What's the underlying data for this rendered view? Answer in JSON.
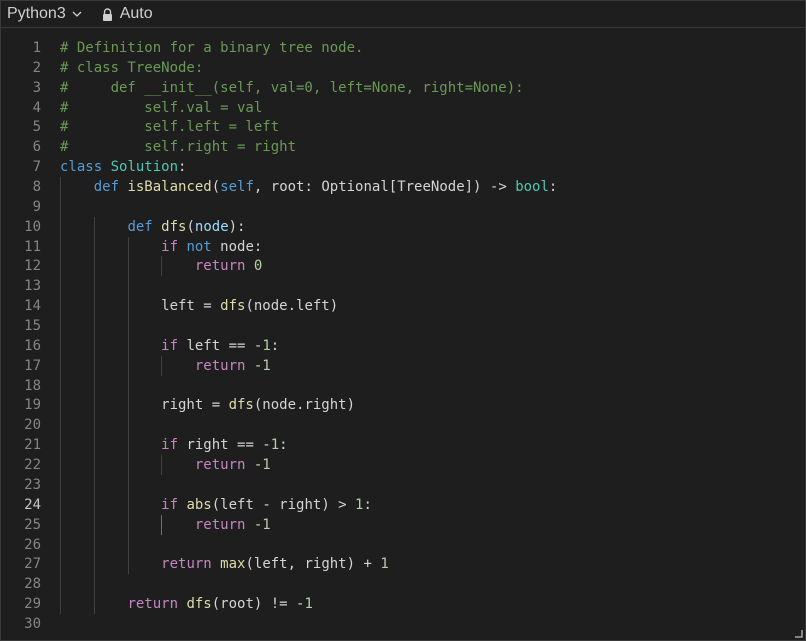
{
  "toolbar": {
    "language": "Python3",
    "language_icon": "chevron-down-icon",
    "mode": "Auto",
    "mode_icon": "lock-icon"
  },
  "editor": {
    "active_line": 24,
    "lines": [
      {
        "n": "1",
        "t": "# Definition for a binary tree node."
      },
      {
        "n": "2",
        "t": "# class TreeNode:"
      },
      {
        "n": "3",
        "t": "#     def __init__(self, val=0, left=None, right=None):"
      },
      {
        "n": "4",
        "t": "#         self.val = val"
      },
      {
        "n": "5",
        "t": "#         self.left = left"
      },
      {
        "n": "6",
        "t": "#         self.right = right"
      },
      {
        "n": "7",
        "t": "class Solution:"
      },
      {
        "n": "8",
        "t": "    def isBalanced(self, root: Optional[TreeNode]) -> bool:"
      },
      {
        "n": "9",
        "t": ""
      },
      {
        "n": "10",
        "t": "        def dfs(node):"
      },
      {
        "n": "11",
        "t": "            if not node:"
      },
      {
        "n": "12",
        "t": "                return 0"
      },
      {
        "n": "13",
        "t": ""
      },
      {
        "n": "14",
        "t": "            left = dfs(node.left)"
      },
      {
        "n": "15",
        "t": ""
      },
      {
        "n": "16",
        "t": "            if left == -1:"
      },
      {
        "n": "17",
        "t": "                return -1"
      },
      {
        "n": "18",
        "t": ""
      },
      {
        "n": "19",
        "t": "            right = dfs(node.right)"
      },
      {
        "n": "20",
        "t": ""
      },
      {
        "n": "21",
        "t": "            if right == -1:"
      },
      {
        "n": "22",
        "t": "                return -1"
      },
      {
        "n": "23",
        "t": ""
      },
      {
        "n": "24",
        "t": "            if abs(left - right) > 1:"
      },
      {
        "n": "25",
        "t": "                return -1"
      },
      {
        "n": "26",
        "t": ""
      },
      {
        "n": "27",
        "t": "            return max(left, right) + 1"
      },
      {
        "n": "28",
        "t": ""
      },
      {
        "n": "29",
        "t": "        return dfs(root) != -1"
      },
      {
        "n": "30",
        "t": ""
      }
    ]
  }
}
